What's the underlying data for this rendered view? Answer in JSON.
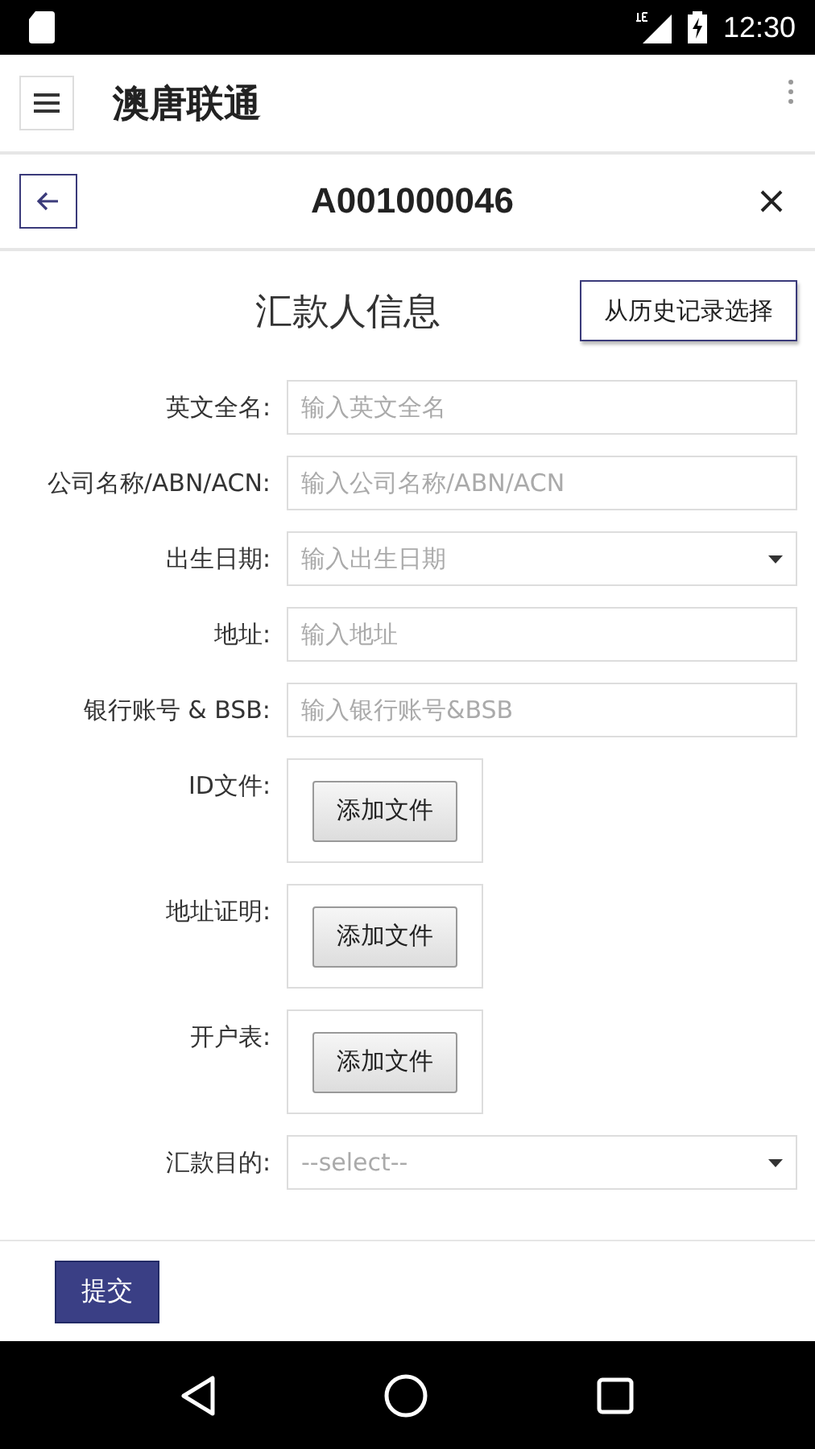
{
  "status_bar": {
    "time": "12:30"
  },
  "toolbar": {
    "title": "澳唐联通"
  },
  "header": {
    "title": "A001000046"
  },
  "section": {
    "title": "汇款人信息",
    "action": "从历史记录选择"
  },
  "fields": [
    {
      "kind": "text",
      "label": "英文全名:",
      "placeholder": "输入英文全名"
    },
    {
      "kind": "text",
      "label": "公司名称/ABN/ACN:",
      "placeholder": "输入公司名称/ABN/ACN"
    },
    {
      "kind": "select",
      "label": "出生日期:",
      "placeholder": "输入出生日期"
    },
    {
      "kind": "text",
      "label": "地址:",
      "placeholder": "输入地址"
    },
    {
      "kind": "text",
      "label": "银行账号 & BSB:",
      "placeholder": "输入银行账号&BSB"
    },
    {
      "kind": "file",
      "label": "ID文件:",
      "button": "添加文件"
    },
    {
      "kind": "file",
      "label": "地址证明:",
      "button": "添加文件"
    },
    {
      "kind": "file",
      "label": "开户表:",
      "button": "添加文件"
    },
    {
      "kind": "select",
      "label": "汇款目的:",
      "placeholder": "--select--"
    }
  ],
  "footer": {
    "submit": "提交"
  }
}
